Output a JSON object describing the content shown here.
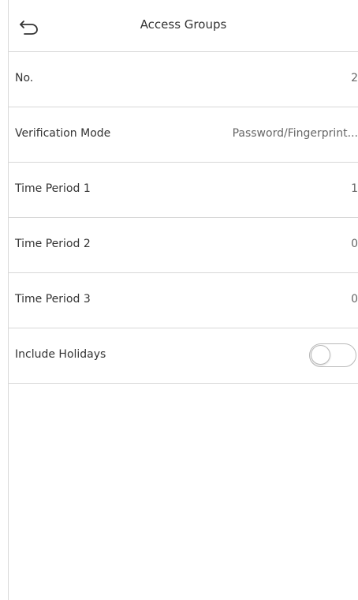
{
  "header": {
    "title": "Access Groups",
    "back_icon": "back-arrow-icon"
  },
  "rows": [
    {
      "label": "No.",
      "value": "2"
    },
    {
      "label": "Verification Mode",
      "value": "Password/Fingerprint..."
    },
    {
      "label": "Time Period 1",
      "value": "1"
    },
    {
      "label": "Time Period 2",
      "value": "0"
    },
    {
      "label": "Time Period 3",
      "value": "0"
    }
  ],
  "holidays": {
    "label": "Include Holidays",
    "enabled": false
  },
  "colors": {
    "divider": "#d8d8d8",
    "text": "#333333",
    "value_text": "#666666",
    "toggle_border": "#b9b9b9"
  }
}
